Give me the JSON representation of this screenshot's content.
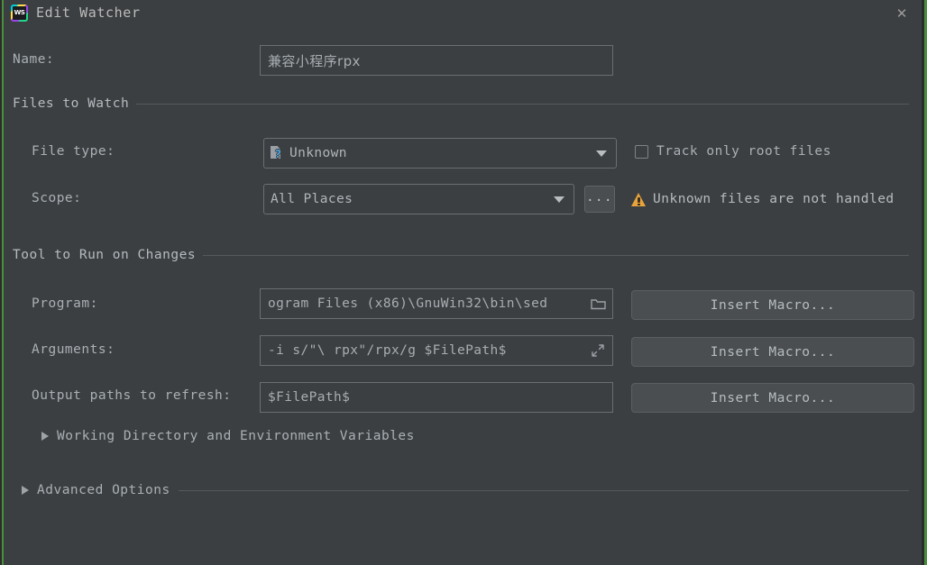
{
  "window": {
    "title": "Edit Watcher",
    "app_icon": "webstorm-icon",
    "app_icon_text": "WS",
    "close_label": "✕"
  },
  "name_row": {
    "label": "Name:",
    "value": "兼容小程序rpx"
  },
  "files_to_watch": {
    "section_title": "Files to Watch",
    "file_type": {
      "label": "File type:",
      "value": "Unknown",
      "icon": "unknown-file-icon"
    },
    "track_only_root": {
      "label": "Track only root files",
      "checked": false
    },
    "scope": {
      "label": "Scope:",
      "value": "All Places",
      "browse_label": "..."
    },
    "warning": {
      "text": "Unknown files are not handled",
      "icon": "warning-triangle-icon",
      "color": "#e8a33d"
    }
  },
  "tool_to_run": {
    "section_title": "Tool to Run on Changes",
    "program": {
      "label": "Program:",
      "value": "ogram Files (x86)\\GnuWin32\\bin\\sed",
      "icon": "folder-browse-icon",
      "macro_label": "Insert Macro..."
    },
    "arguments": {
      "label": "Arguments:",
      "value": "-i s/\"\\ rpx\"/rpx/g $FilePath$",
      "icon": "expand-editor-icon",
      "macro_label": "Insert Macro..."
    },
    "output_paths": {
      "label": "Output paths to refresh:",
      "value": "$FilePath$",
      "macro_label": "Insert Macro..."
    },
    "working_directory": {
      "label": "Working Directory and Environment Variables",
      "expanded": false
    }
  },
  "advanced_options": {
    "label": "Advanced Options",
    "expanded": false
  },
  "colors": {
    "background": "#3c3f41",
    "field_border": "#6b6f71",
    "text": "#a9b0b5",
    "button_face": "#4a4e50",
    "warning": "#e8a33d",
    "accent_blue": "#4a9fd8"
  }
}
